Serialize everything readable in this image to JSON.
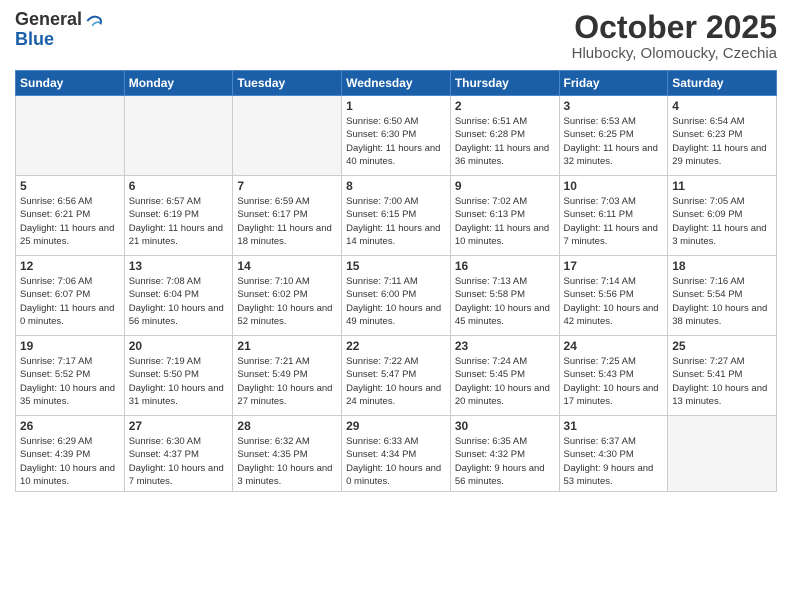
{
  "logo": {
    "general": "General",
    "blue": "Blue"
  },
  "header": {
    "month": "October 2025",
    "location": "Hlubocky, Olomoucky, Czechia"
  },
  "days_of_week": [
    "Sunday",
    "Monday",
    "Tuesday",
    "Wednesday",
    "Thursday",
    "Friday",
    "Saturday"
  ],
  "weeks": [
    [
      {
        "day": "",
        "empty": true
      },
      {
        "day": "",
        "empty": true
      },
      {
        "day": "",
        "empty": true
      },
      {
        "day": "1",
        "sunrise": "Sunrise: 6:50 AM",
        "sunset": "Sunset: 6:30 PM",
        "daylight": "Daylight: 11 hours and 40 minutes."
      },
      {
        "day": "2",
        "sunrise": "Sunrise: 6:51 AM",
        "sunset": "Sunset: 6:28 PM",
        "daylight": "Daylight: 11 hours and 36 minutes."
      },
      {
        "day": "3",
        "sunrise": "Sunrise: 6:53 AM",
        "sunset": "Sunset: 6:25 PM",
        "daylight": "Daylight: 11 hours and 32 minutes."
      },
      {
        "day": "4",
        "sunrise": "Sunrise: 6:54 AM",
        "sunset": "Sunset: 6:23 PM",
        "daylight": "Daylight: 11 hours and 29 minutes."
      }
    ],
    [
      {
        "day": "5",
        "sunrise": "Sunrise: 6:56 AM",
        "sunset": "Sunset: 6:21 PM",
        "daylight": "Daylight: 11 hours and 25 minutes."
      },
      {
        "day": "6",
        "sunrise": "Sunrise: 6:57 AM",
        "sunset": "Sunset: 6:19 PM",
        "daylight": "Daylight: 11 hours and 21 minutes."
      },
      {
        "day": "7",
        "sunrise": "Sunrise: 6:59 AM",
        "sunset": "Sunset: 6:17 PM",
        "daylight": "Daylight: 11 hours and 18 minutes."
      },
      {
        "day": "8",
        "sunrise": "Sunrise: 7:00 AM",
        "sunset": "Sunset: 6:15 PM",
        "daylight": "Daylight: 11 hours and 14 minutes."
      },
      {
        "day": "9",
        "sunrise": "Sunrise: 7:02 AM",
        "sunset": "Sunset: 6:13 PM",
        "daylight": "Daylight: 11 hours and 10 minutes."
      },
      {
        "day": "10",
        "sunrise": "Sunrise: 7:03 AM",
        "sunset": "Sunset: 6:11 PM",
        "daylight": "Daylight: 11 hours and 7 minutes."
      },
      {
        "day": "11",
        "sunrise": "Sunrise: 7:05 AM",
        "sunset": "Sunset: 6:09 PM",
        "daylight": "Daylight: 11 hours and 3 minutes."
      }
    ],
    [
      {
        "day": "12",
        "sunrise": "Sunrise: 7:06 AM",
        "sunset": "Sunset: 6:07 PM",
        "daylight": "Daylight: 11 hours and 0 minutes."
      },
      {
        "day": "13",
        "sunrise": "Sunrise: 7:08 AM",
        "sunset": "Sunset: 6:04 PM",
        "daylight": "Daylight: 10 hours and 56 minutes."
      },
      {
        "day": "14",
        "sunrise": "Sunrise: 7:10 AM",
        "sunset": "Sunset: 6:02 PM",
        "daylight": "Daylight: 10 hours and 52 minutes."
      },
      {
        "day": "15",
        "sunrise": "Sunrise: 7:11 AM",
        "sunset": "Sunset: 6:00 PM",
        "daylight": "Daylight: 10 hours and 49 minutes."
      },
      {
        "day": "16",
        "sunrise": "Sunrise: 7:13 AM",
        "sunset": "Sunset: 5:58 PM",
        "daylight": "Daylight: 10 hours and 45 minutes."
      },
      {
        "day": "17",
        "sunrise": "Sunrise: 7:14 AM",
        "sunset": "Sunset: 5:56 PM",
        "daylight": "Daylight: 10 hours and 42 minutes."
      },
      {
        "day": "18",
        "sunrise": "Sunrise: 7:16 AM",
        "sunset": "Sunset: 5:54 PM",
        "daylight": "Daylight: 10 hours and 38 minutes."
      }
    ],
    [
      {
        "day": "19",
        "sunrise": "Sunrise: 7:17 AM",
        "sunset": "Sunset: 5:52 PM",
        "daylight": "Daylight: 10 hours and 35 minutes."
      },
      {
        "day": "20",
        "sunrise": "Sunrise: 7:19 AM",
        "sunset": "Sunset: 5:50 PM",
        "daylight": "Daylight: 10 hours and 31 minutes."
      },
      {
        "day": "21",
        "sunrise": "Sunrise: 7:21 AM",
        "sunset": "Sunset: 5:49 PM",
        "daylight": "Daylight: 10 hours and 27 minutes."
      },
      {
        "day": "22",
        "sunrise": "Sunrise: 7:22 AM",
        "sunset": "Sunset: 5:47 PM",
        "daylight": "Daylight: 10 hours and 24 minutes."
      },
      {
        "day": "23",
        "sunrise": "Sunrise: 7:24 AM",
        "sunset": "Sunset: 5:45 PM",
        "daylight": "Daylight: 10 hours and 20 minutes."
      },
      {
        "day": "24",
        "sunrise": "Sunrise: 7:25 AM",
        "sunset": "Sunset: 5:43 PM",
        "daylight": "Daylight: 10 hours and 17 minutes."
      },
      {
        "day": "25",
        "sunrise": "Sunrise: 7:27 AM",
        "sunset": "Sunset: 5:41 PM",
        "daylight": "Daylight: 10 hours and 13 minutes."
      }
    ],
    [
      {
        "day": "26",
        "sunrise": "Sunrise: 6:29 AM",
        "sunset": "Sunset: 4:39 PM",
        "daylight": "Daylight: 10 hours and 10 minutes."
      },
      {
        "day": "27",
        "sunrise": "Sunrise: 6:30 AM",
        "sunset": "Sunset: 4:37 PM",
        "daylight": "Daylight: 10 hours and 7 minutes."
      },
      {
        "day": "28",
        "sunrise": "Sunrise: 6:32 AM",
        "sunset": "Sunset: 4:35 PM",
        "daylight": "Daylight: 10 hours and 3 minutes."
      },
      {
        "day": "29",
        "sunrise": "Sunrise: 6:33 AM",
        "sunset": "Sunset: 4:34 PM",
        "daylight": "Daylight: 10 hours and 0 minutes."
      },
      {
        "day": "30",
        "sunrise": "Sunrise: 6:35 AM",
        "sunset": "Sunset: 4:32 PM",
        "daylight": "Daylight: 9 hours and 56 minutes."
      },
      {
        "day": "31",
        "sunrise": "Sunrise: 6:37 AM",
        "sunset": "Sunset: 4:30 PM",
        "daylight": "Daylight: 9 hours and 53 minutes."
      },
      {
        "day": "",
        "empty": true
      }
    ]
  ]
}
